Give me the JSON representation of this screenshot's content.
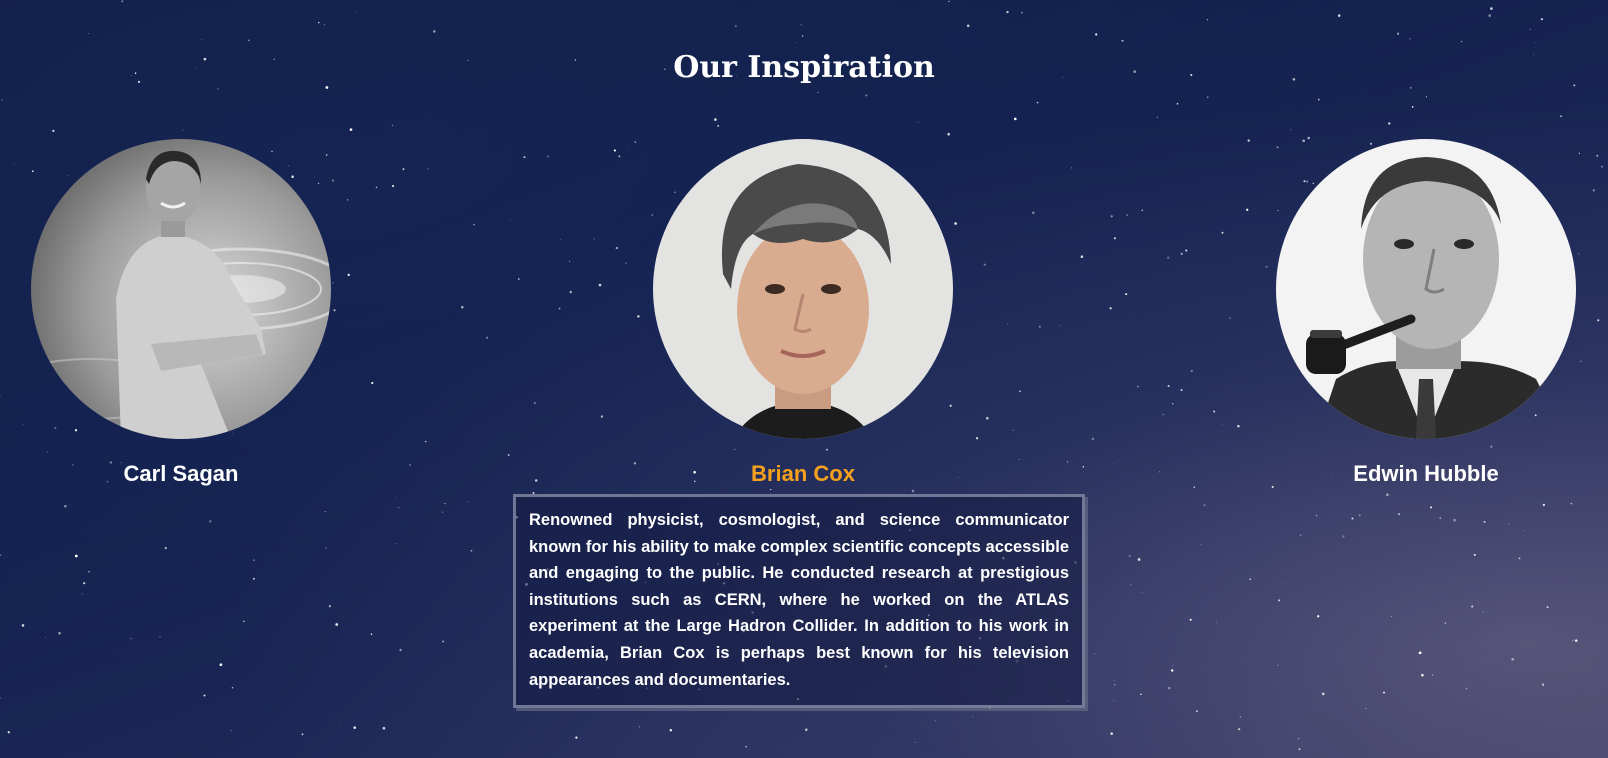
{
  "section": {
    "title": "Our Inspiration"
  },
  "people": [
    {
      "name": "Carl Sagan",
      "active": false,
      "photo": "carl-sagan-photo"
    },
    {
      "name": "Brian Cox",
      "active": true,
      "photo": "brian-cox-photo"
    },
    {
      "name": "Edwin Hubble",
      "active": false,
      "photo": "edwin-hubble-photo"
    }
  ],
  "bio": {
    "text": "Renowned physicist, cosmologist, and science communicator known for his ability to make complex scientific concepts accessible and engaging to the public. He conducted research at prestigious institutions such as CERN, where he worked on the ATLAS experiment at the Large Hadron Collider. In addition to his work in academia, Brian Cox is perhaps best known for his television appearances and documentaries."
  },
  "colors": {
    "background": "#13214f",
    "highlight": "#f4a01c",
    "text": "#ffffff"
  }
}
